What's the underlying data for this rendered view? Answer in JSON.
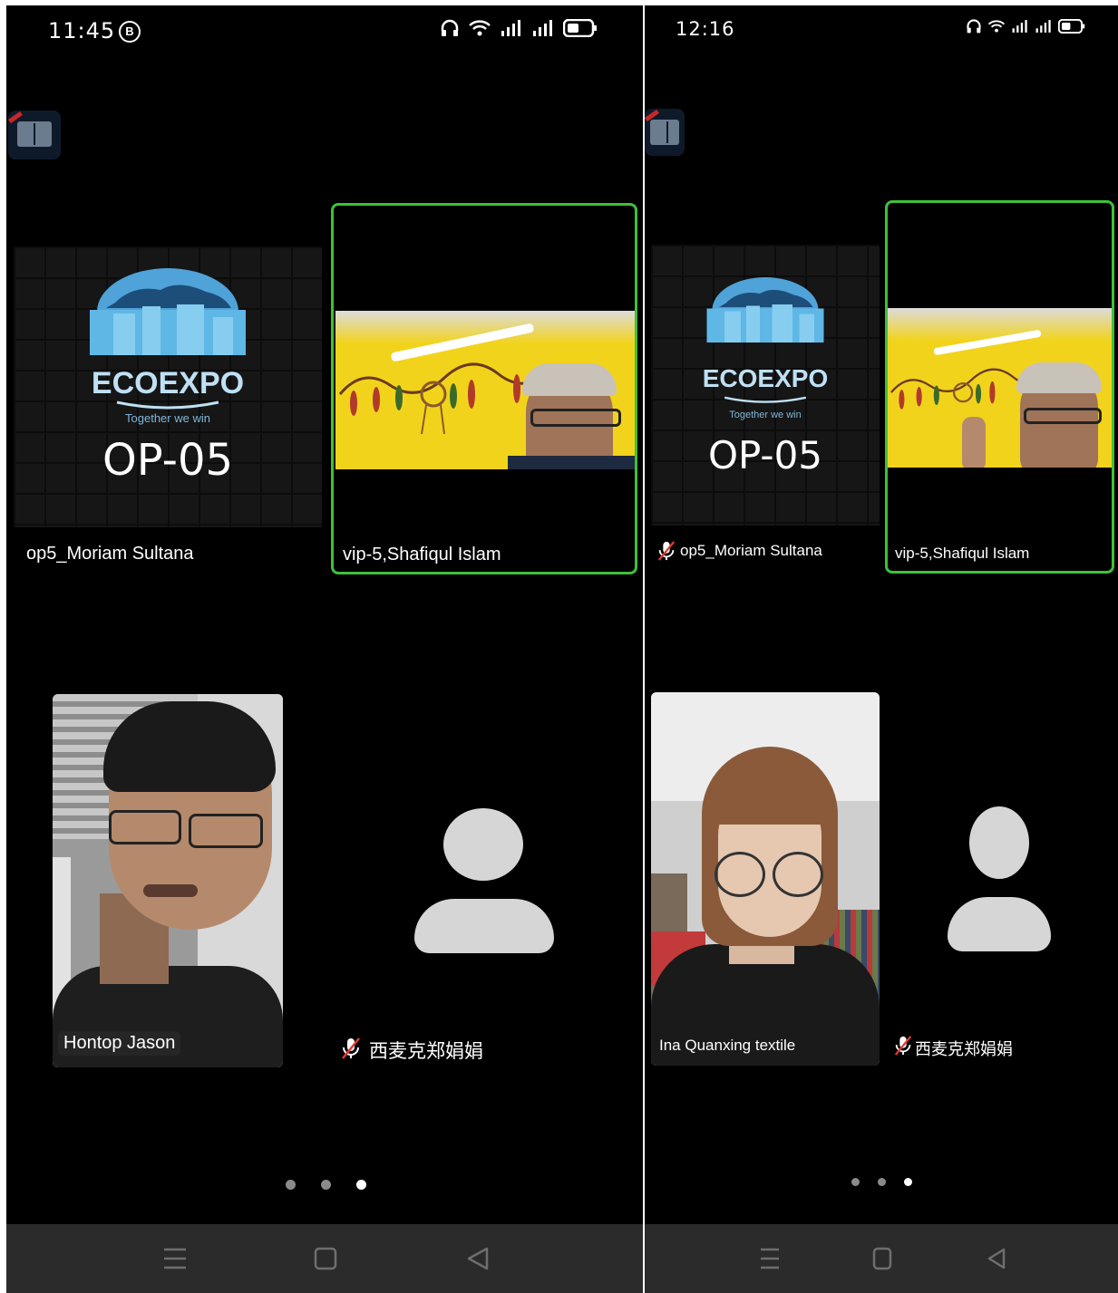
{
  "left": {
    "status": {
      "time": "11:45",
      "notif_icon": "B"
    },
    "tiles": {
      "presenter": {
        "logo_text": "ECOEXPO",
        "tagline": "Together we win",
        "code": "OP-05",
        "name": "op5_Moriam Sultana"
      },
      "active_speaker": {
        "name": "vip-5,Shafiqul Islam"
      },
      "video_user": {
        "name": "Hontop Jason"
      },
      "avatar_user": {
        "name": "西麦克郑娟娟",
        "muted": true
      }
    },
    "pagination": {
      "count": 3,
      "active": 3
    }
  },
  "right": {
    "status": {
      "time": "12:16"
    },
    "tiles": {
      "presenter": {
        "logo_text": "ECOEXPO",
        "tagline": "Together we win",
        "code": "OP-05",
        "name": "op5_Moriam Sultana",
        "muted": true
      },
      "active_speaker": {
        "name": "vip-5,Shafiqul Islam"
      },
      "video_user": {
        "name": "Ina Quanxing textile"
      },
      "avatar_user": {
        "name": "西麦克郑娟娟",
        "muted": true
      }
    },
    "pagination": {
      "count": 3,
      "active": 3
    }
  },
  "colors": {
    "active_border": "#3fc03c",
    "wall": "#f2d31c",
    "nav_bar": "#2b2b2b"
  }
}
